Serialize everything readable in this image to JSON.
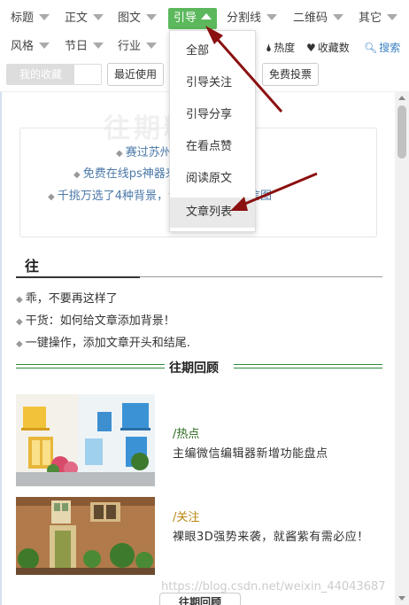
{
  "categories_row1": [
    "标题",
    "正文",
    "图文",
    "引导",
    "分割线",
    "二维码",
    "其它"
  ],
  "categories_row2": [
    "风格",
    "节日",
    "行业"
  ],
  "active_category": "引导",
  "tools": {
    "hot": "热度",
    "fav": "收藏数",
    "search": "搜索"
  },
  "tabs": {
    "my_fav": "我的收藏",
    "recent": "最近使用",
    "free_vote": "免费投票"
  },
  "dropdown": [
    "全部",
    "引导关注",
    "引导分享",
    "在看点赞",
    "阅读原文",
    "文章列表"
  ],
  "dropdown_selected": "文章列表",
  "content": {
    "ghost_title": "往期精选",
    "links": [
      "赛过苏州园林？美的来了",
      "免费在线ps神器来了，了解一下?",
      "千挑万选了4种背景，让你花式玩转微信图"
    ],
    "section_title": "往",
    "plain_items": [
      "乖，不要再这样了",
      "干货：如何给文章添加背景！",
      "一键操作，添加文章开头和结尾."
    ],
    "divider_title": "往期回顾",
    "articles": [
      {
        "tag": "/热点",
        "tag_color": "#2a6a1e",
        "title": "主编微信编辑器新增功能盘点"
      },
      {
        "tag": "/关注",
        "tag_color": "#b8860b",
        "title": "裸眼3D强势来袭，就酱紫有需必应！"
      }
    ],
    "bottom_title": "往期回顾"
  },
  "watermark": "https://blog.csdn.net/weixin_44043687",
  "colors": {
    "accent": "#5cb85c",
    "arrow": "#8b1010",
    "link": "#4a78a8",
    "divider": "#2e8b3e"
  }
}
